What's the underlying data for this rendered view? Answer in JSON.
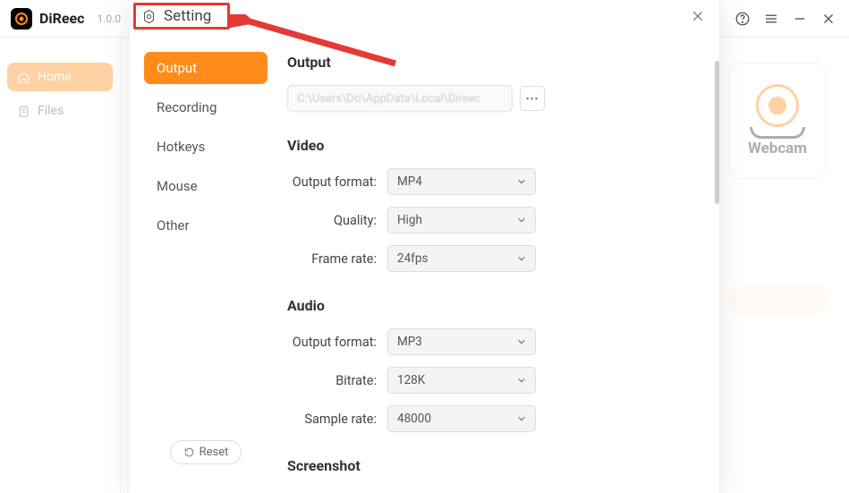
{
  "app": {
    "name": "DiReec",
    "version": "1.0.0"
  },
  "leftNav": {
    "home": "Home",
    "files": "Files"
  },
  "main": {
    "webcam": "Webcam"
  },
  "dialog": {
    "title": "Setting",
    "nav": {
      "output": "Output",
      "recording": "Recording",
      "hotkeys": "Hotkeys",
      "mouse": "Mouse",
      "other": "Other"
    },
    "reset": "Reset",
    "sections": {
      "output": {
        "title": "Output",
        "path": "C:\\Users\\Do\\AppData\\Local\\Direec"
      },
      "video": {
        "title": "Video",
        "output_format_label": "Output format:",
        "output_format_value": "MP4",
        "quality_label": "Quality:",
        "quality_value": "High",
        "frame_rate_label": "Frame rate:",
        "frame_rate_value": "24fps"
      },
      "audio": {
        "title": "Audio",
        "output_format_label": "Output format:",
        "output_format_value": "MP3",
        "bitrate_label": "Bitrate:",
        "bitrate_value": "128K",
        "sample_rate_label": "Sample rate:",
        "sample_rate_value": "48000"
      },
      "screenshot": {
        "title": "Screenshot"
      }
    }
  }
}
